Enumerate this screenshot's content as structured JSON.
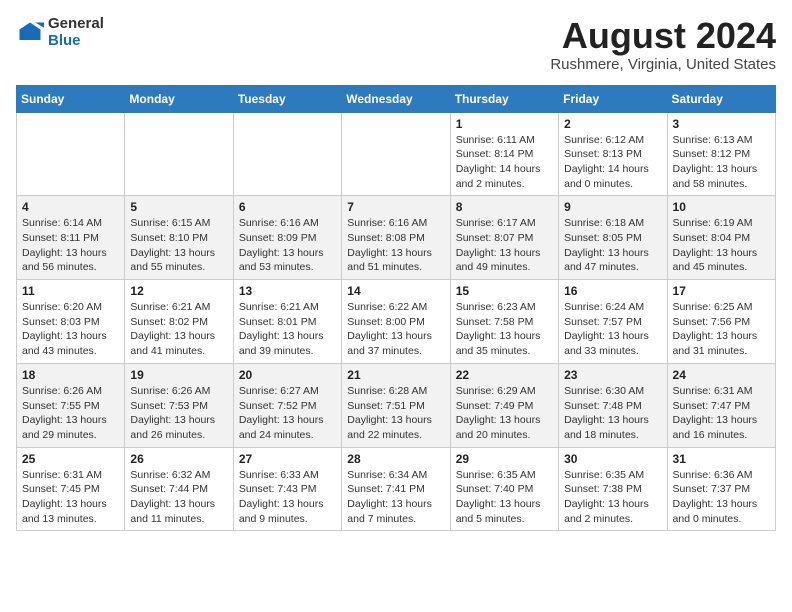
{
  "header": {
    "logo": {
      "line1": "General",
      "line2": "Blue"
    },
    "title": "August 2024",
    "subtitle": "Rushmere, Virginia, United States"
  },
  "weekdays": [
    "Sunday",
    "Monday",
    "Tuesday",
    "Wednesday",
    "Thursday",
    "Friday",
    "Saturday"
  ],
  "weeks": [
    [
      {
        "day": "",
        "info": ""
      },
      {
        "day": "",
        "info": ""
      },
      {
        "day": "",
        "info": ""
      },
      {
        "day": "",
        "info": ""
      },
      {
        "day": "1",
        "info": "Sunrise: 6:11 AM\nSunset: 8:14 PM\nDaylight: 14 hours\nand 2 minutes."
      },
      {
        "day": "2",
        "info": "Sunrise: 6:12 AM\nSunset: 8:13 PM\nDaylight: 14 hours\nand 0 minutes."
      },
      {
        "day": "3",
        "info": "Sunrise: 6:13 AM\nSunset: 8:12 PM\nDaylight: 13 hours\nand 58 minutes."
      }
    ],
    [
      {
        "day": "4",
        "info": "Sunrise: 6:14 AM\nSunset: 8:11 PM\nDaylight: 13 hours\nand 56 minutes."
      },
      {
        "day": "5",
        "info": "Sunrise: 6:15 AM\nSunset: 8:10 PM\nDaylight: 13 hours\nand 55 minutes."
      },
      {
        "day": "6",
        "info": "Sunrise: 6:16 AM\nSunset: 8:09 PM\nDaylight: 13 hours\nand 53 minutes."
      },
      {
        "day": "7",
        "info": "Sunrise: 6:16 AM\nSunset: 8:08 PM\nDaylight: 13 hours\nand 51 minutes."
      },
      {
        "day": "8",
        "info": "Sunrise: 6:17 AM\nSunset: 8:07 PM\nDaylight: 13 hours\nand 49 minutes."
      },
      {
        "day": "9",
        "info": "Sunrise: 6:18 AM\nSunset: 8:05 PM\nDaylight: 13 hours\nand 47 minutes."
      },
      {
        "day": "10",
        "info": "Sunrise: 6:19 AM\nSunset: 8:04 PM\nDaylight: 13 hours\nand 45 minutes."
      }
    ],
    [
      {
        "day": "11",
        "info": "Sunrise: 6:20 AM\nSunset: 8:03 PM\nDaylight: 13 hours\nand 43 minutes."
      },
      {
        "day": "12",
        "info": "Sunrise: 6:21 AM\nSunset: 8:02 PM\nDaylight: 13 hours\nand 41 minutes."
      },
      {
        "day": "13",
        "info": "Sunrise: 6:21 AM\nSunset: 8:01 PM\nDaylight: 13 hours\nand 39 minutes."
      },
      {
        "day": "14",
        "info": "Sunrise: 6:22 AM\nSunset: 8:00 PM\nDaylight: 13 hours\nand 37 minutes."
      },
      {
        "day": "15",
        "info": "Sunrise: 6:23 AM\nSunset: 7:58 PM\nDaylight: 13 hours\nand 35 minutes."
      },
      {
        "day": "16",
        "info": "Sunrise: 6:24 AM\nSunset: 7:57 PM\nDaylight: 13 hours\nand 33 minutes."
      },
      {
        "day": "17",
        "info": "Sunrise: 6:25 AM\nSunset: 7:56 PM\nDaylight: 13 hours\nand 31 minutes."
      }
    ],
    [
      {
        "day": "18",
        "info": "Sunrise: 6:26 AM\nSunset: 7:55 PM\nDaylight: 13 hours\nand 29 minutes."
      },
      {
        "day": "19",
        "info": "Sunrise: 6:26 AM\nSunset: 7:53 PM\nDaylight: 13 hours\nand 26 minutes."
      },
      {
        "day": "20",
        "info": "Sunrise: 6:27 AM\nSunset: 7:52 PM\nDaylight: 13 hours\nand 24 minutes."
      },
      {
        "day": "21",
        "info": "Sunrise: 6:28 AM\nSunset: 7:51 PM\nDaylight: 13 hours\nand 22 minutes."
      },
      {
        "day": "22",
        "info": "Sunrise: 6:29 AM\nSunset: 7:49 PM\nDaylight: 13 hours\nand 20 minutes."
      },
      {
        "day": "23",
        "info": "Sunrise: 6:30 AM\nSunset: 7:48 PM\nDaylight: 13 hours\nand 18 minutes."
      },
      {
        "day": "24",
        "info": "Sunrise: 6:31 AM\nSunset: 7:47 PM\nDaylight: 13 hours\nand 16 minutes."
      }
    ],
    [
      {
        "day": "25",
        "info": "Sunrise: 6:31 AM\nSunset: 7:45 PM\nDaylight: 13 hours\nand 13 minutes."
      },
      {
        "day": "26",
        "info": "Sunrise: 6:32 AM\nSunset: 7:44 PM\nDaylight: 13 hours\nand 11 minutes."
      },
      {
        "day": "27",
        "info": "Sunrise: 6:33 AM\nSunset: 7:43 PM\nDaylight: 13 hours\nand 9 minutes."
      },
      {
        "day": "28",
        "info": "Sunrise: 6:34 AM\nSunset: 7:41 PM\nDaylight: 13 hours\nand 7 minutes."
      },
      {
        "day": "29",
        "info": "Sunrise: 6:35 AM\nSunset: 7:40 PM\nDaylight: 13 hours\nand 5 minutes."
      },
      {
        "day": "30",
        "info": "Sunrise: 6:35 AM\nSunset: 7:38 PM\nDaylight: 13 hours\nand 2 minutes."
      },
      {
        "day": "31",
        "info": "Sunrise: 6:36 AM\nSunset: 7:37 PM\nDaylight: 13 hours\nand 0 minutes."
      }
    ]
  ]
}
